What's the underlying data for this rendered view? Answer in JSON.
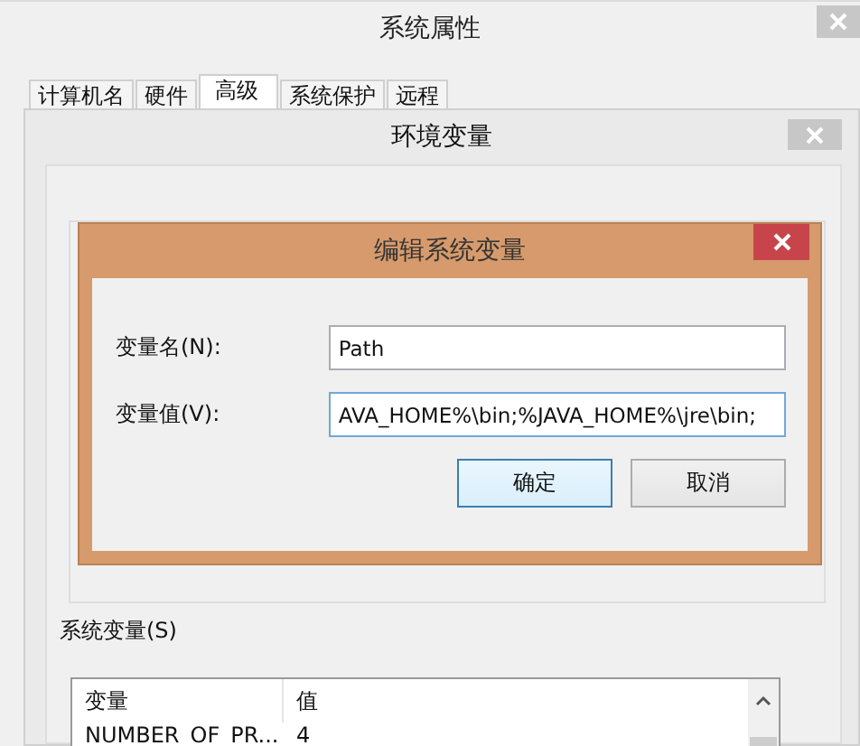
{
  "system_properties": {
    "title": "系统属性",
    "tabs": [
      {
        "label": "计算机名",
        "selected": false
      },
      {
        "label": "硬件",
        "selected": false
      },
      {
        "label": "高级",
        "selected": true
      },
      {
        "label": "系统保护",
        "selected": false
      },
      {
        "label": "远程",
        "selected": false
      }
    ]
  },
  "environment_variables": {
    "title": "环境变量",
    "system_group": {
      "label": "系统变量(S)",
      "columns": [
        "变量",
        "值"
      ],
      "rows": [
        {
          "name": "NUMBER_OF_PR...",
          "value": "4"
        }
      ]
    }
  },
  "edit_dialog": {
    "title": "编辑系统变量",
    "fields": [
      {
        "label": "变量名(N):",
        "value": "Path"
      },
      {
        "label": "变量值(V):",
        "value": "AVA_HOME%\\bin;%JAVA_HOME%\\jre\\bin;"
      }
    ],
    "buttons": [
      {
        "label": "确定",
        "default": true
      },
      {
        "label": "取消",
        "default": false
      }
    ]
  }
}
